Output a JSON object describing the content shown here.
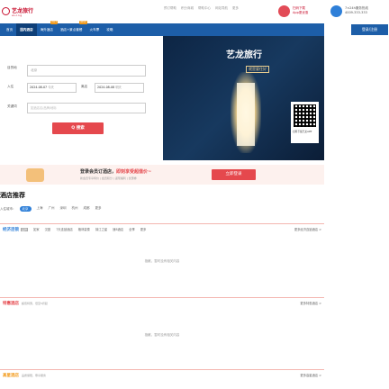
{
  "header": {
    "logo_text": "艺龙旅行",
    "logo_sub": "eLong",
    "top_links": [
      "预订帮助",
      "积分商城",
      "帮助中心",
      "网站导航",
      "更多"
    ],
    "miniapp_line1": "扫码下载",
    "miniapp_line2": "App更优惠",
    "hotline_line1": "7×24h服务热线",
    "hotline_line2": "4009-333-333"
  },
  "nav": {
    "items": [
      {
        "label": "首页",
        "badge": ""
      },
      {
        "label": "国内酒店",
        "badge": ""
      },
      {
        "label": "海外酒店",
        "badge": "HOT"
      },
      {
        "label": "酒店+景点套餐",
        "badge": "NEW"
      },
      {
        "label": "火车票",
        "badge": ""
      },
      {
        "label": "攻略",
        "badge": ""
      }
    ],
    "active_index": 1,
    "login_label": "登录/注册"
  },
  "search": {
    "city_label": "目的地",
    "city_placeholder": "北京",
    "checkin_label": "入住",
    "checkin_value": "2024-08-07",
    "checkin_day": "今天",
    "checkout_label": "离店",
    "checkout_value": "2024-08-08",
    "checkout_day": "明天",
    "keyword_label": "关键词",
    "keyword_placeholder": "如酒店名/品牌/地标",
    "search_button": "Q 搜索"
  },
  "banner": {
    "brand_name": "艺龙旅行",
    "slogan": "就是要住好",
    "qr_caption": "扫码下载艺龙APP"
  },
  "promo": {
    "text_main": "登录会员订酒店，",
    "text_highlight": "即刻享受超值价~",
    "text_sub": "新会员专享特价 | 会员积分 | 返现福利 | 优惠券",
    "button": "立即登录"
  },
  "recommend": {
    "title": "酒店推荐",
    "city_prefix": "入住城市：",
    "cities": [
      "北京",
      "上海",
      "广州",
      "深圳",
      "杭州",
      "成都",
      "更多"
    ],
    "selected_city_index": 0
  },
  "sections": [
    {
      "title": "经济连锁",
      "title_color": "#2e7fd8",
      "tag": "品牌",
      "tabs": [
        "如家",
        "汉庭",
        "7天连锁酒店",
        "格林豪泰",
        "锦江之星",
        "速8酒店",
        "全季",
        "更多"
      ],
      "desc": "",
      "more": "更多经济连锁酒店 >",
      "empty": "抱歉，暂时没有相关内容"
    },
    {
      "title": "特惠酒店",
      "title_color": "#e5484d",
      "tag": "",
      "tabs": [],
      "desc": "超值特惠，低至5折起",
      "more": "更多特惠酒店 >",
      "empty": "抱歉，暂时没有相关内容"
    },
    {
      "title": "高星酒店",
      "title_color": "#f39a1a",
      "tag": "",
      "tabs": [],
      "desc": "品质保障，尊享服务",
      "more": "更多高星酒店 >",
      "empty": ""
    }
  ]
}
